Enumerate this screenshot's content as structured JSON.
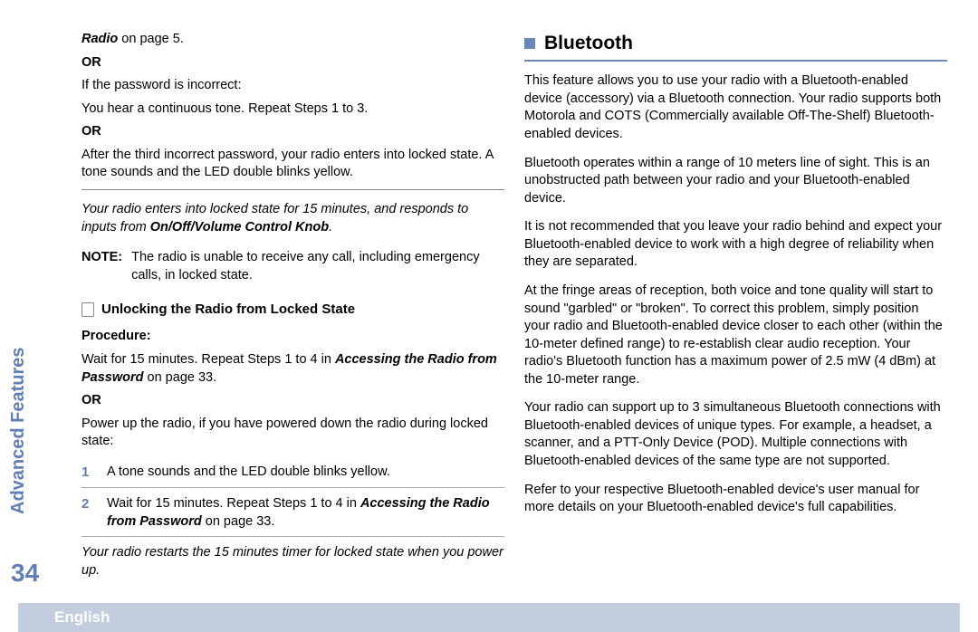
{
  "sideTitle": "Advanced Features",
  "pageNumber": "34",
  "footerLang": "English",
  "left": {
    "line1_a": "Radio",
    "line1_b": " on page 5.",
    "or1": "OR",
    "line2": "If the password is incorrect:",
    "line3": "You hear a continuous tone. Repeat Steps 1 to 3.",
    "or2": "OR",
    "line4": "After the third incorrect password, your radio enters into locked state. A tone sounds and the LED double blinks yellow.",
    "lockedNote_a": "Your radio enters into locked state for 15 minutes, and responds to inputs from ",
    "lockedNote_b": "On/Off/Volume Control Knob",
    "lockedNote_c": ".",
    "noteLabel": "NOTE:",
    "noteBody": "The radio is unable to receive any call, including emergency calls, in locked state.",
    "subhead": "Unlocking the Radio from Locked State",
    "procLabel": "Procedure:",
    "proc1_a": "Wait for 15 minutes. Repeat Steps 1 to 4 in ",
    "proc1_b": "Accessing the Radio from Password",
    "proc1_c": " on page 33.",
    "or3": "OR",
    "proc2": "Power up the radio, if you have powered down the radio during locked state:",
    "step1num": "1",
    "step1": "A tone sounds and the LED double blinks yellow.",
    "step2num": "2",
    "step2_a": "Wait for 15 minutes. Repeat Steps 1 to 4 in ",
    "step2_b": "Accessing the Radio from Password",
    "step2_c": " on page 33.",
    "restartNote": "Your radio restarts the 15 minutes timer for locked state when you power up."
  },
  "right": {
    "heading": "Bluetooth",
    "p1": "This feature allows you to use your radio with a Bluetooth-enabled device (accessory) via a Bluetooth connection. Your radio supports both Motorola and COTS (Commercially available Off-The-Shelf) Bluetooth-enabled devices.",
    "p2": "Bluetooth operates within a range of 10 meters line of sight. This is an unobstructed path between your radio and your Bluetooth-enabled device.",
    "p3": "It is not recommended that you leave your radio behind and expect your Bluetooth-enabled device to work with a high degree of reliability when they are separated.",
    "p4": "At the fringe areas of reception, both voice and tone quality will start to sound \"garbled\" or \"broken\". To correct this problem, simply position your radio and Bluetooth-enabled device closer to each other (within the 10-meter defined range) to re-establish clear audio reception. Your radio's Bluetooth function has a maximum power of 2.5 mW (4 dBm) at the 10-meter range.",
    "p5": "Your radio can support up to 3 simultaneous Bluetooth connections with Bluetooth-enabled devices of unique types. For example, a headset, a scanner, and a PTT-Only Device (POD). Multiple connections with Bluetooth-enabled devices of the same type are not supported.",
    "p6": "Refer to your respective Bluetooth-enabled device's user manual for more details on your Bluetooth-enabled device's full capabilities."
  }
}
